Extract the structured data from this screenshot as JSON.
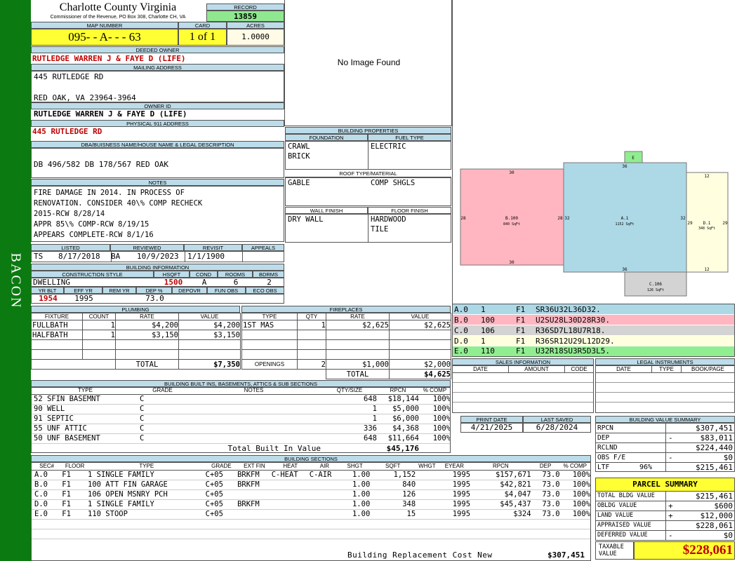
{
  "sidebar": {
    "label": "BACON"
  },
  "header": {
    "county": "Charlotte County Virginia",
    "commissioner": "Commissioner of the Revenue, PO Box 308, Charlotte CH, VA",
    "record_label": "RECORD",
    "record": "13859"
  },
  "map": {
    "map_label": "MAP NUMBER",
    "card_label": "CARD",
    "acres_label": "ACRES",
    "map_number": "095- - A- - - 63",
    "card": "1 of 1",
    "acres": "1.0000"
  },
  "owner": {
    "deeded_label": "DEEDED OWNER",
    "deeded": "RUTLEDGE WARREN J & FAYE D (LIFE)",
    "mailing_label": "MAILING ADDRESS",
    "address1": "445 RUTLEDGE RD",
    "address2": "RED OAK, VA 23964-3964",
    "owner_id_label": "OWNER ID",
    "owner_id": "RUTLEDGE WARREN J & FAYE D (LIFE)",
    "physical_label": "PHYSICAL 911 ADDRESS",
    "physical": "445 RUTLEDGE RD"
  },
  "legal": {
    "label": "DBA/BUISNESS NAME/HOUSE NAME & LEGAL DESCRIPTION",
    "text": "DB 496/582 DB 178/567 RED OAK"
  },
  "notes": {
    "label": "NOTES",
    "lines": [
      "FIRE DAMAGE IN 2014. IN PROCESS OF",
      "RENOVATION. CONSIDER 40\\% COMP RECHECK",
      "2015-RCW 8/28/14",
      "APPR 85\\% COMP-RCW 8/19/15",
      "APPEARS COMPLETE-RCW 8/1/16"
    ]
  },
  "dates": {
    "listed_label": "LISTED",
    "reviewed_label": "REVIEWED",
    "revisit_label": "REVISIT",
    "appeals_label": "APPEALS",
    "listed_by": "TS",
    "listed": "8/17/2018",
    "reviewed_by": "BA",
    "reviewed": "10/9/2023",
    "revisit": "1/1/1900",
    "appeals": ""
  },
  "building_info": {
    "label": "BUILDING INFORMATION",
    "cs_label": "CONSTRUCTION STYLE",
    "hsqft_label": "HSQFT",
    "cond_label": "COND",
    "rooms_label": "ROOMS",
    "bdrms_label": "BDRMS",
    "style": "DWELLING",
    "hsqft": "1500",
    "cond": "A",
    "rooms": "6",
    "bdrms": "2",
    "yrblt_label": "YR BLT",
    "effyr_label": "EFF YR",
    "remyr_label": "REM YR",
    "dep_label": "DEP %",
    "depovr_label": "DEPOVR",
    "funobs_label": "FUN OBS",
    "ecoobs_label": "ECO OBS",
    "yrblt": "1954",
    "effyr": "1995",
    "remyr": "",
    "dep": "73.0",
    "depovr": "",
    "funobs": "",
    "ecoobs": ""
  },
  "photo": {
    "text": "No Image Found"
  },
  "bprops": {
    "label": "BUILDING PROPERTIES",
    "foundation_label": "FOUNDATION",
    "fuel_label": "FUEL TYPE",
    "foundation": [
      "CRAWL",
      "BRICK"
    ],
    "fuel": "ELECTRIC",
    "roof_label": "ROOF TYPE/MATERIAL",
    "roof_type": "GABLE",
    "roof_mat": "COMP SHGLS",
    "wall_label": "WALL FINISH",
    "floor_label": "FLOOR FINISH",
    "wall": "DRY WALL",
    "floor": [
      "HARDWOOD",
      "TILE"
    ]
  },
  "sketch": {
    "a_label": "A.1",
    "a_area": "1152 SqFt",
    "b_label": "B.100",
    "b_area": "840 SqFt",
    "c_label": "C.106",
    "c_area": "126 SqFt",
    "d_label": "D.1",
    "d_area": "348 SqFt",
    "e_label": "E",
    "dims": {
      "b_top": "30",
      "b_bottom": "30",
      "b_left": "28",
      "b_right": "28",
      "a_top": "36",
      "a_bottom": "36",
      "a_left": "32",
      "a_right": "32",
      "d_top": "12",
      "d_bottom": "12",
      "d_left": "29",
      "d_right": "29"
    },
    "colors": {
      "a": "#add8e6",
      "b": "#ffb6c1",
      "c": "#d3d3d3",
      "d": "#ffffe0",
      "e": "#90ee90"
    }
  },
  "sketch_codes": [
    {
      "code": "A.0",
      "n": "1",
      "fl": "F1",
      "path": "SR36U32L36D32.",
      "color": "#add8e6"
    },
    {
      "code": "B.0",
      "n": "100",
      "fl": "F1",
      "path": "U2SU28L30D28R30.",
      "color": "#ffb6c1"
    },
    {
      "code": "C.0",
      "n": "106",
      "fl": "F1",
      "path": "R36SD7L18U7R18.",
      "color": "#d3d3d3"
    },
    {
      "code": "D.0",
      "n": "1",
      "fl": "F1",
      "path": "R36SR12U29L12D29.",
      "color": "#ffffe0"
    },
    {
      "code": "E.0",
      "n": "110",
      "fl": "F1",
      "path": "U32R18SU3R5D3L5.",
      "color": "#90ee90"
    }
  ],
  "plumbing": {
    "label": "PLUMBING",
    "headers": [
      "FIXTURE",
      "COUNT",
      "RATE",
      "VALUE"
    ],
    "rows": [
      [
        "FULLBATH",
        "1",
        "$4,200",
        "$4,200"
      ],
      [
        "HALFBATH",
        "1",
        "$3,150",
        "$3,150"
      ]
    ],
    "total_label": "TOTAL",
    "total": "$7,350"
  },
  "fireplaces": {
    "label": "FIREPLACES",
    "headers": [
      "TYPE",
      "QTY",
      "RATE",
      "VALUE"
    ],
    "rows": [
      [
        "1ST MAS",
        "1",
        "$2,625",
        "$2,625"
      ]
    ],
    "openings_label": "OPENINGS",
    "openings_qty": "2",
    "openings_rate": "$1,000",
    "openings_value": "$2,000",
    "total_label": "TOTAL",
    "total": "$4,625"
  },
  "sales": {
    "label": "SALES INFORMATION",
    "headers": [
      "DATE",
      "AMOUNT",
      "CODE"
    ]
  },
  "legal_instruments": {
    "label": "LEGAL INSTRUMENTS",
    "headers": [
      "DATE",
      "TYPE",
      "BOOK/PAGE"
    ]
  },
  "print": {
    "print_label": "PRINT DATE",
    "saved_label": "LAST SAVED",
    "print_date": "4/21/2025",
    "saved": "6/28/2024"
  },
  "builtins": {
    "label": "BUILDING BUILT INS, BASEMENTS, ATTICS & SUB SECTIONS",
    "headers": [
      "TYPE",
      "GRADE",
      "NOTES",
      "QTY/SIZE",
      "RPCN",
      "% COMP"
    ],
    "rows": [
      [
        "52 SFIN BASEMNT",
        "C",
        "",
        "648",
        "$18,144",
        "100%"
      ],
      [
        "90 WELL",
        "C",
        "",
        "1",
        "$5,000",
        "100%"
      ],
      [
        "91 SEPTIC",
        "C",
        "",
        "1",
        "$6,000",
        "100%"
      ],
      [
        "55 UNF ATTIC",
        "C",
        "",
        "336",
        "$4,368",
        "100%"
      ],
      [
        "50 UNF BASEMENT",
        "C",
        "",
        "648",
        "$11,664",
        "100%"
      ]
    ],
    "total_label": "Total Built In Value",
    "total": "$45,176"
  },
  "value_summary": {
    "label": "BUILDING VALUE SUMMARY",
    "rows": [
      {
        "label": "RPCN",
        "sign": "",
        "value": "$307,451"
      },
      {
        "label": "DEP",
        "sign": "-",
        "value": "$83,011"
      },
      {
        "label": "RCLND",
        "sign": "",
        "value": "$224,440"
      },
      {
        "label": "OBS F/E",
        "sign": "-",
        "value": "$0"
      },
      {
        "label": "LTF",
        "sign": "96%",
        "value": "$215,461"
      }
    ]
  },
  "sections": {
    "label": "BUILDING SECTIONS",
    "headers": [
      "SEC#",
      "FLOOR",
      "TYPE",
      "GRADE",
      "EXT FIN",
      "HEAT",
      "AIR",
      "SHGT",
      "SQFT",
      "WHGT",
      "EYEAR",
      "RPCN",
      "DEP",
      "% COMP"
    ],
    "rows": [
      [
        "A.0",
        "F1",
        "1 SINGLE FAMILY",
        "C+05",
        "BRKFM",
        "C-HEAT",
        "C-AIR",
        "1.00",
        "1,152",
        "",
        "1995",
        "$157,671",
        "73.0",
        "100%"
      ],
      [
        "B.0",
        "F1",
        "100 ATT FIN GARAGE",
        "C+05",
        "BRKFM",
        "",
        "",
        "1.00",
        "840",
        "",
        "1995",
        "$42,821",
        "73.0",
        "100%"
      ],
      [
        "C.0",
        "F1",
        "106 OPEN MSNRY PCH",
        "C+05",
        "",
        "",
        "",
        "1.00",
        "126",
        "",
        "1995",
        "$4,047",
        "73.0",
        "100%"
      ],
      [
        "D.0",
        "F1",
        "1 SINGLE FAMILY",
        "C+05",
        "BRKFM",
        "",
        "",
        "1.00",
        "348",
        "",
        "1995",
        "$45,437",
        "73.0",
        "100%"
      ],
      [
        "E.0",
        "F1",
        "110 STOOP",
        "C+05",
        "",
        "",
        "",
        "1.00",
        "15",
        "",
        "1995",
        "$324",
        "73.0",
        "100%"
      ]
    ],
    "brcn_label": "Building Replacement Cost New",
    "brcn": "$307,451"
  },
  "parcel": {
    "label": "PARCEL SUMMARY",
    "rows": [
      {
        "label": "TOTAL BLDG VALUE",
        "sign": "",
        "value": "$215,461"
      },
      {
        "label": "OBLDG VALUE",
        "sign": "+",
        "value": "$600"
      },
      {
        "label": "LAND VALUE",
        "sign": "+",
        "value": "$12,000"
      },
      {
        "label": "APPRAISED VALUE",
        "sign": "",
        "value": "$228,061"
      },
      {
        "label": "DEFERRED VALUE",
        "sign": "-",
        "value": "$0"
      }
    ],
    "taxable_label": "TAXABLE VALUE",
    "taxable": "$228,061"
  }
}
